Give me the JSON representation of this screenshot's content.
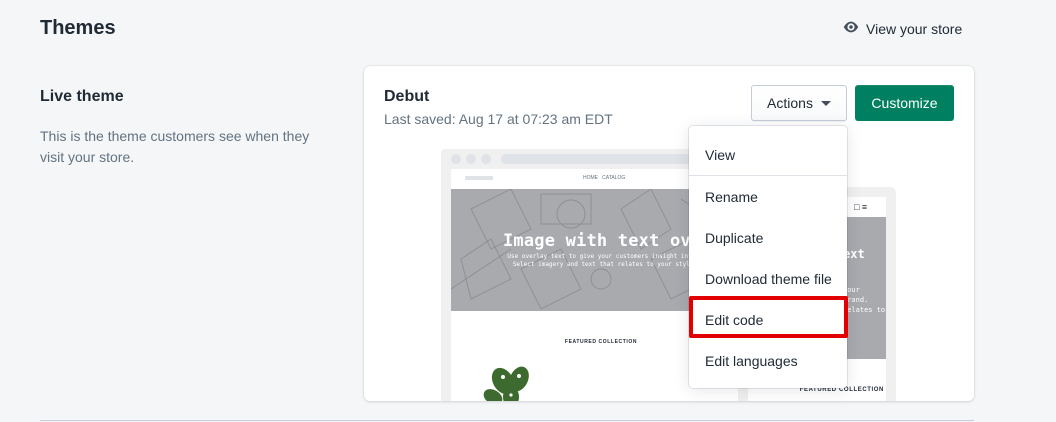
{
  "header": {
    "title": "Themes",
    "view_store_label": "View your store",
    "view_store_icon": "eye-icon"
  },
  "section": {
    "heading": "Live theme",
    "description": "This is the theme customers see when they visit your store."
  },
  "theme_card": {
    "name": "Debut",
    "last_saved": "Last saved: Aug 17 at 07:23 am EDT",
    "actions_label": "Actions",
    "customize_label": "Customize",
    "accent_color": "#008060"
  },
  "preview": {
    "desktop_hero_title": "Image with text overlay",
    "desktop_hero_sub": "Use overlay text to give your customers insight into your brand. Select imagery and text that relates to your style and story.",
    "featured_collection": "FEATURED COLLECTION",
    "mobile_hero_title": "ext",
    "mobile_hero_sub": "your brand. relates to",
    "mobile_featured": "FEATURED COLLECTION"
  },
  "actions_menu": {
    "items": [
      {
        "label": "View"
      },
      {
        "label": "Rename"
      },
      {
        "label": "Duplicate"
      },
      {
        "label": "Download theme file"
      },
      {
        "label": "Edit code"
      },
      {
        "label": "Edit languages"
      }
    ],
    "highlighted_item": "Edit code",
    "highlight_color": "#e30000"
  }
}
